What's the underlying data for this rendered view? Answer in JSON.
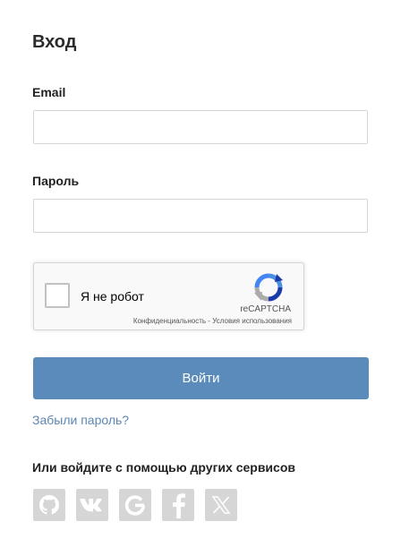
{
  "form": {
    "title": "Вход",
    "email_label": "Email",
    "email_value": "",
    "password_label": "Пароль",
    "password_value": "",
    "submit_label": "Войти",
    "forgot_label": "Забыли пароль?"
  },
  "captcha": {
    "label": "Я не робот",
    "checked": false,
    "brand": "reCAPTCHA",
    "privacy": "Конфиденциальность",
    "separator": "-",
    "terms": "Условия использования"
  },
  "social": {
    "title": "Или войдите с помощью других сервисов",
    "icons": [
      "github-icon",
      "vk-icon",
      "google-icon",
      "facebook-icon",
      "x-icon"
    ]
  },
  "colors": {
    "accent": "#5a8bbb",
    "link": "#5d86b4",
    "social_bg": "#d6d6d6"
  }
}
